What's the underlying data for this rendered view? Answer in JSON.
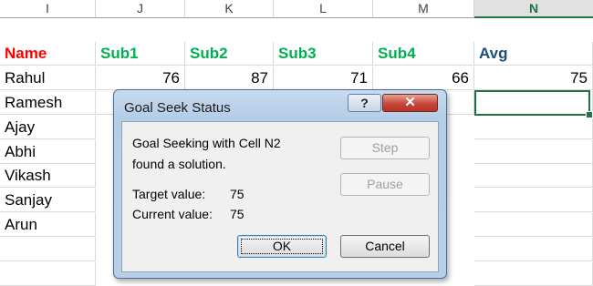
{
  "sheet": {
    "columns": [
      "I",
      "J",
      "K",
      "L",
      "M",
      "N"
    ],
    "active_column": "N",
    "headers": [
      "Name",
      "Sub1",
      "Sub2",
      "Sub3",
      "Sub4",
      "Avg"
    ],
    "rows": [
      {
        "name": "Rahul",
        "sub1": "76",
        "sub2": "87",
        "sub3": "71",
        "sub4": "66",
        "avg": "75"
      },
      {
        "name": "Ramesh",
        "sub1": "",
        "sub2": "",
        "sub3": "",
        "sub4": "",
        "avg": ""
      },
      {
        "name": "Ajay",
        "sub1": "",
        "sub2": "",
        "sub3": "",
        "sub4": "",
        "avg": ""
      },
      {
        "name": "Abhi",
        "sub1": "",
        "sub2": "",
        "sub3": "",
        "sub4": "",
        "avg": ""
      },
      {
        "name": "Vikash",
        "sub1": "",
        "sub2": "",
        "sub3": "",
        "sub4": "",
        "avg": ""
      },
      {
        "name": "Sanjay",
        "sub1": "",
        "sub2": "",
        "sub3": "",
        "sub4": "",
        "avg": ""
      },
      {
        "name": "Arun",
        "sub1": "",
        "sub2": "",
        "sub3": "",
        "sub4": "",
        "avg": ""
      },
      {
        "name": "",
        "sub1": "",
        "sub2": "",
        "sub3": "",
        "sub4": "",
        "avg": ""
      }
    ],
    "colors": {
      "name_header": "#ff0000",
      "sub_header": "#00b050",
      "avg_header": "#1f4e79",
      "selection": "#217346"
    }
  },
  "dialog": {
    "title": "Goal Seek Status",
    "help_label": "?",
    "close_label": "✕",
    "message_line1": "Goal Seeking with Cell N2",
    "message_line2": "found a solution.",
    "target_label": "Target value:",
    "target_value": "75",
    "current_label": "Current value:",
    "current_value": "75",
    "step_label": "Step",
    "pause_label": "Pause",
    "ok_label": "OK",
    "cancel_label": "Cancel"
  }
}
